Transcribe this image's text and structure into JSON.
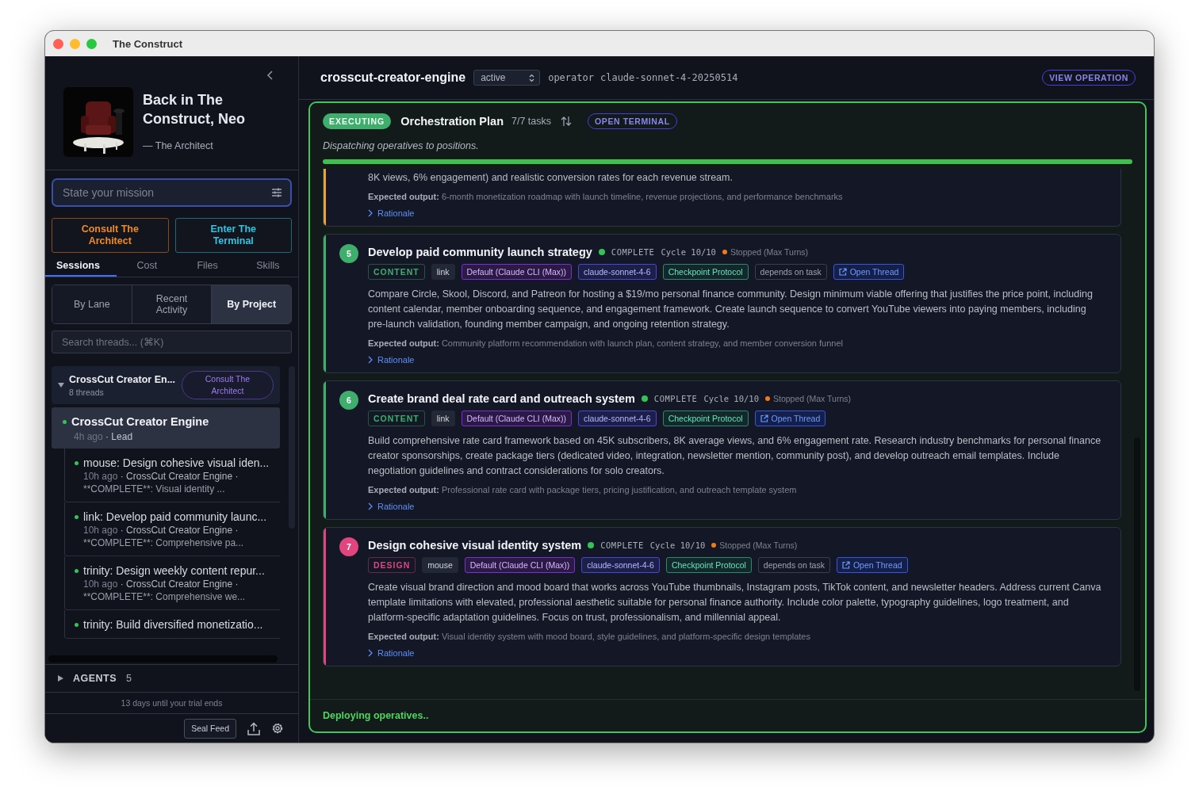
{
  "window": {
    "title": "The Construct"
  },
  "sidebar": {
    "greeting": {
      "title": "Back in The Construct, Neo",
      "attribution": "— The Architect"
    },
    "mission": {
      "placeholder": "State your mission"
    },
    "actions": [
      {
        "kind": "architect",
        "label": "Consult The Architect"
      },
      {
        "kind": "terminal",
        "label": "Enter The Terminal"
      }
    ],
    "tabs": [
      {
        "label": "Sessions",
        "selected": true
      },
      {
        "label": "Cost",
        "selected": false
      },
      {
        "label": "Files",
        "selected": false
      },
      {
        "label": "Skills",
        "selected": false
      }
    ],
    "views": [
      {
        "label": "By Lane",
        "selected": false
      },
      {
        "label": "Recent Activity",
        "selected": false
      },
      {
        "label": "By Project",
        "selected": true
      }
    ],
    "search": {
      "placeholder": "Search threads... (⌘K)"
    },
    "project": {
      "name": "CrossCut Creator En...",
      "count": "8 threads",
      "expanded": true,
      "action": "Consult The Architect"
    },
    "threads": [
      {
        "title": "CrossCut Creator Engine",
        "time": "4h ago",
        "role": "· Lead",
        "selected": true,
        "children": [
          {
            "title": "mouse: Design cohesive visual iden...",
            "time": "10h ago",
            "project": "· CrossCut Creator Engine  ·",
            "summary": "**COMPLETE**: Visual identity ...",
            "selected": false
          },
          {
            "title": "link: Develop paid community launc...",
            "time": "10h ago",
            "project": "· CrossCut Creator Engine  ·",
            "summary": "**COMPLETE**: Comprehensive pa...",
            "selected": false
          },
          {
            "title": "trinity: Design weekly content repur...",
            "time": "10h ago",
            "project": "· CrossCut Creator Engine  ·",
            "summary": "**COMPLETE**: Comprehensive we...",
            "selected": false
          },
          {
            "title": "trinity: Build diversified monetizatio...",
            "selected": false
          }
        ]
      }
    ],
    "agents": {
      "label": "AGENTS",
      "count": "5",
      "expanded": false
    },
    "trial": "13 days until your trial ends",
    "seal_button": "Seal Feed"
  },
  "main": {
    "operation": {
      "name": "crosscut-creator-engine",
      "state": "active",
      "operator_label": "operator",
      "operator": "claude-sonnet-4-20250514",
      "view_button": "VIEW OPERATION"
    },
    "plan": {
      "status": "EXECUTING",
      "title": "Orchestration Plan",
      "count": "7/7 tasks",
      "terminal_button": "OPEN TERMINAL",
      "message": "Dispatching operatives to positions.",
      "level": 1,
      "tasks": [
        {
          "color": "#e8a23a",
          "description": "8K views, 6% engagement) and realistic conversion rates for each revenue stream.",
          "expected": "**Expected output:** 6-month monetization roadmap with launch timeline, revenue projections, and performance benchmarks",
          "rationale": "Rationale"
        },
        {
          "number": "5",
          "color": "#3fae6d",
          "title": "Develop paid community launch strategy",
          "status": "COMPLETE",
          "cycle": "Cycle 10/10",
          "stop": "Stopped (Max Turns)",
          "tags": [
            {
              "kind": "category",
              "label": "CONTENT"
            },
            {
              "kind": "agent",
              "label": "link"
            },
            {
              "kind": "profile",
              "label": "Default (Claude CLI (Max))"
            },
            {
              "kind": "model",
              "label": "claude-sonnet-4-6"
            },
            {
              "kind": "protocol",
              "label": "Checkpoint Protocol"
            },
            {
              "kind": "dependency",
              "label": "depends on task"
            },
            {
              "kind": "thread",
              "label": "Open Thread"
            }
          ],
          "description": "Compare Circle, Skool, Discord, and Patreon for hosting a $19/mo personal finance community. Design minimum viable offering that justifies the price point, including content calendar, member onboarding sequence, and engagement framework. Create launch sequence to convert YouTube viewers into paying members, including pre-launch validation, founding member campaign, and ongoing retention strategy.",
          "expected": "**Expected output:** Community platform recommendation with launch plan, content strategy, and member conversion funnel",
          "rationale": "Rationale"
        },
        {
          "number": "6",
          "color": "#3fae6d",
          "title": "Create brand deal rate card and outreach system",
          "status": "COMPLETE",
          "cycle": "Cycle 10/10",
          "stop": "Stopped (Max Turns)",
          "tags": [
            {
              "kind": "category",
              "label": "CONTENT"
            },
            {
              "kind": "agent",
              "label": "link"
            },
            {
              "kind": "profile",
              "label": "Default (Claude CLI (Max))"
            },
            {
              "kind": "model",
              "label": "claude-sonnet-4-6"
            },
            {
              "kind": "protocol",
              "label": "Checkpoint Protocol"
            },
            {
              "kind": "thread",
              "label": "Open Thread"
            }
          ],
          "description": "Build comprehensive rate card framework based on 45K subscribers, 8K average views, and 6% engagement rate. Research industry benchmarks for personal finance creator sponsorships, create package tiers (dedicated video, integration, newsletter mention, community post), and develop outreach email templates. Include negotiation guidelines and contract considerations for solo creators.",
          "expected": "**Expected output:** Professional rate card with package tiers, pricing justification, and outreach template system",
          "rationale": "Rationale"
        },
        {
          "number": "7",
          "color": "#e0457e",
          "title": "Design cohesive visual identity system",
          "status": "COMPLETE",
          "cycle": "Cycle 10/10",
          "stop": "Stopped (Max Turns)",
          "tags": [
            {
              "kind": "category",
              "label": "DESIGN"
            },
            {
              "kind": "agent",
              "label": "mouse"
            },
            {
              "kind": "profile",
              "label": "Default (Claude CLI (Max))"
            },
            {
              "kind": "model",
              "label": "claude-sonnet-4-6"
            },
            {
              "kind": "protocol",
              "label": "Checkpoint Protocol"
            },
            {
              "kind": "dependency",
              "label": "depends on task"
            },
            {
              "kind": "thread",
              "label": "Open Thread"
            }
          ],
          "description": "Create visual brand direction and mood board that works across YouTube thumbnails, Instagram posts, TikTok content, and newsletter headers. Address current Canva template limitations with elevated, professional aesthetic suitable for personal finance authority. Include color palette, typography guidelines, logo treatment, and platform-specific adaptation guidelines. Focus on trust, professionalism, and millennial appeal.",
          "expected": "**Expected output:** Visual identity system with mood board, style guidelines, and platform-specific design templates",
          "rationale": "Rationale"
        }
      ],
      "footer": "Deploying operatives.."
    }
  }
}
